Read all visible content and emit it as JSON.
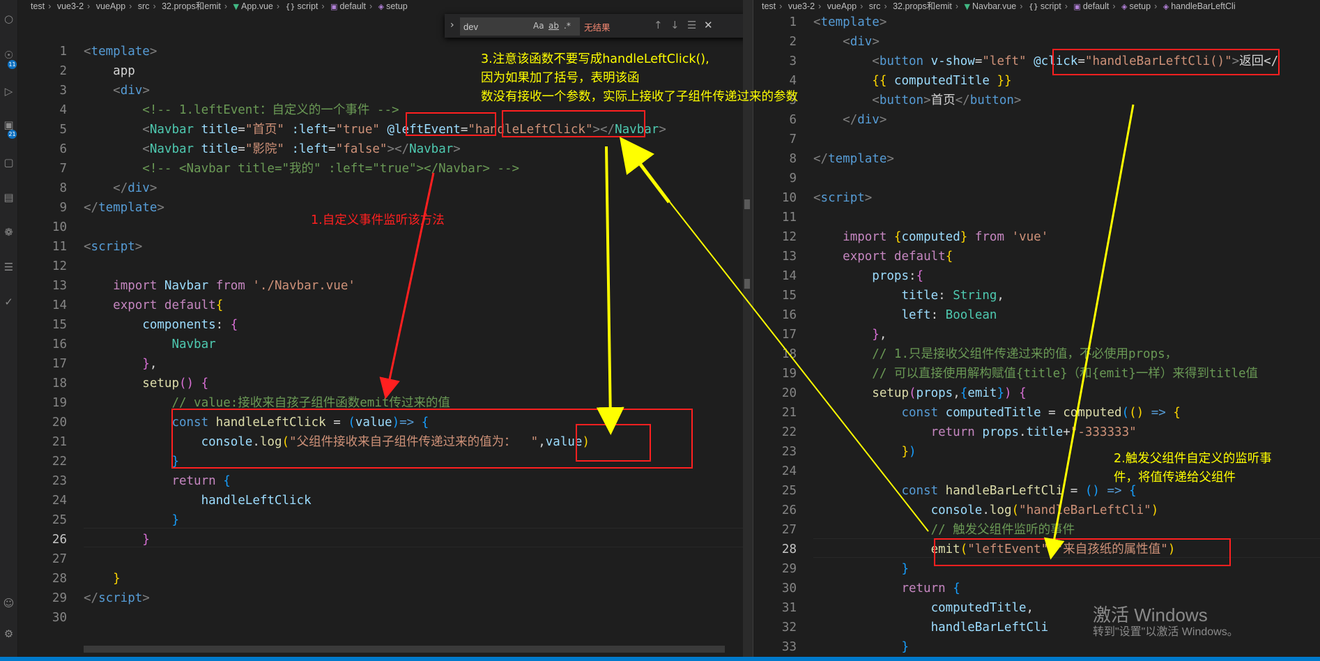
{
  "left_editor": {
    "breadcrumb": [
      "test",
      "vue3-2",
      "vueApp",
      "src",
      "32.props和emit",
      "App.vue",
      "script",
      "default",
      "setup"
    ],
    "line_numbers": [
      "1",
      "2",
      "3",
      "4",
      "5",
      "6",
      "7",
      "8",
      "9",
      "10",
      "11",
      "12",
      "13",
      "14",
      "15",
      "16",
      "17",
      "18",
      "19",
      "20",
      "21",
      "22",
      "23",
      "24",
      "25",
      "26",
      "27",
      "28",
      "29",
      "30"
    ],
    "active_line": "26",
    "find": {
      "value": "dev",
      "options": [
        "Aa",
        "ab",
        ".*"
      ],
      "result": "无结果"
    }
  },
  "right_editor": {
    "breadcrumb": [
      "test",
      "vue3-2",
      "vueApp",
      "src",
      "32.props和emit",
      "Navbar.vue",
      "script",
      "default",
      "setup",
      "handleBarLeftCli"
    ],
    "line_numbers": [
      "1",
      "2",
      "3",
      "4",
      "5",
      "6",
      "7",
      "8",
      "9",
      "10",
      "11",
      "12",
      "13",
      "14",
      "15",
      "16",
      "17",
      "18",
      "19",
      "20",
      "21",
      "22",
      "23",
      "24",
      "25",
      "26",
      "27",
      "28",
      "29",
      "30",
      "31",
      "32",
      "33"
    ],
    "active_line": "28"
  },
  "annotations": {
    "note1": "1.自定义事件监听该方法",
    "note2_line1": "2.触发父组件自定义的监听事",
    "note2_line2": "件，将值传递给父组件",
    "note3_line1": "3.注意该函数不要写成handleLeftClick(),",
    "note3_line2": "因为如果加了括号，表明该函",
    "note3_line3": "数没有接收一个参数，实际上接收了子组件传递过来的参数"
  },
  "watermark": {
    "title": "激活 Windows",
    "subtitle": "转到\"设置\"以激活 Windows。"
  },
  "activity_badges": [
    "11",
    "21"
  ],
  "colors": {
    "editor_bg": "#1e1e1e",
    "annotation_red": "#ff2020",
    "annotation_yellow": "#ffff00",
    "status_bar": "#007acc"
  }
}
